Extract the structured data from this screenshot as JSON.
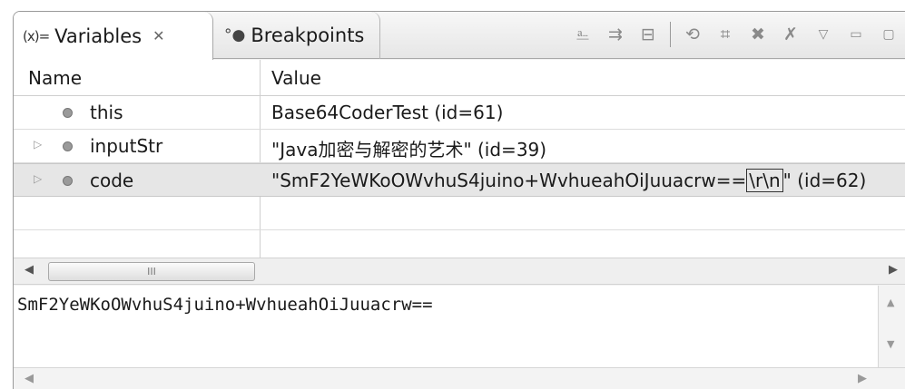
{
  "tabs": [
    {
      "label": "Variables",
      "icon": "variables-icon",
      "glyph": "(x)=",
      "close": "✕"
    },
    {
      "label": "Breakpoints",
      "icon": "breakpoints-icon",
      "glyph": "●"
    }
  ],
  "table": {
    "columns": [
      "Name",
      "Value"
    ],
    "rows": [
      {
        "name": "this",
        "value": "Base64CoderTest  (id=61)"
      },
      {
        "name": "inputStr",
        "value": "\"Java加密与解密的艺术\" (id=39)"
      },
      {
        "name": "code",
        "value_prefix": "\"SmF2YeWKoOWvhuS4juino+WvhueahOiJuuacrw==",
        "value_highlight": "\\r\\n",
        "value_suffix": "\" (id=62)"
      }
    ]
  },
  "scroll": {
    "thumb_grip": "III"
  },
  "detail": {
    "text": "SmF2YeWKoOWvhuS4juino+WvhueahOiJuuacrw=="
  },
  "toolbar": {
    "icons": [
      "show-type-names-icon",
      "show-logical-structure-icon",
      "collapse-all-icon",
      "link-icon",
      "remove-selected-icon",
      "remove-icon",
      "remove-all-icon",
      "view-menu-icon",
      "minimize-icon",
      "maximize-icon"
    ]
  }
}
